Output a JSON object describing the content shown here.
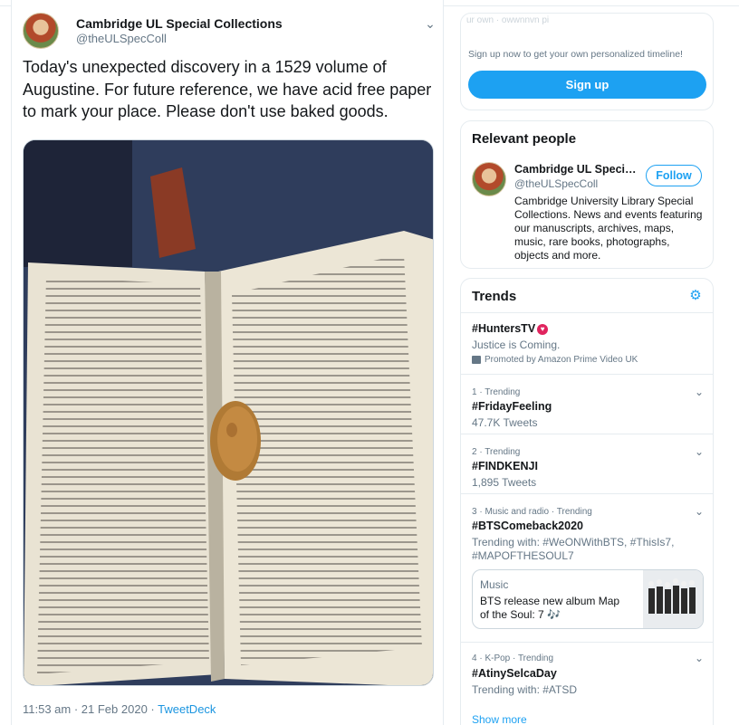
{
  "tweet": {
    "display_name": "Cambridge UL Special Collections",
    "handle": "@theULSpecColl",
    "text": "Today's unexpected discovery in a 1529 volume of Augustine. For future reference, we have acid free paper to mark your place. Please don't use baked goods.",
    "timestamp": "11:53 am · 21 Feb 2020 · ",
    "source_app": "TweetDeck"
  },
  "signup": {
    "faded_header": "ur own · owwnnvn pi",
    "note": "Sign up now to get your own personalized timeline!",
    "button": "Sign up"
  },
  "relevant_people": {
    "title": "Relevant people",
    "name": "Cambridge UL Special...",
    "handle": "@theULSpecColl",
    "follow": "Follow",
    "bio": "Cambridge University Library Special Collections. News and events featuring our manuscripts, archives, maps, music, rare books, photographs, objects and more."
  },
  "trends": {
    "title": "Trends",
    "items": [
      {
        "meta": "",
        "name": "#HuntersTV",
        "sub": "Justice is Coming.",
        "promo": "Promoted by Amazon Prime Video UK"
      },
      {
        "meta": "1 · Trending",
        "name": "#FridayFeeling",
        "sub": "47.7K Tweets"
      },
      {
        "meta": "2 · Trending",
        "name": "#FINDKENJI",
        "sub": "1,895 Tweets"
      },
      {
        "meta": "3 · Music and radio · Trending",
        "name": "#BTSComeback2020",
        "sub": "Trending with: #WeONWithBTS, #ThisIs7, #MAPOFTHESOUL7"
      },
      {
        "meta": "4 · K-Pop · Trending",
        "name": "#AtinySelcaDay",
        "sub": "Trending with: #ATSD"
      }
    ],
    "news": {
      "label": "Music",
      "text": "BTS release new album Map of the Soul: 7 🎶"
    },
    "show_more": "Show more"
  }
}
